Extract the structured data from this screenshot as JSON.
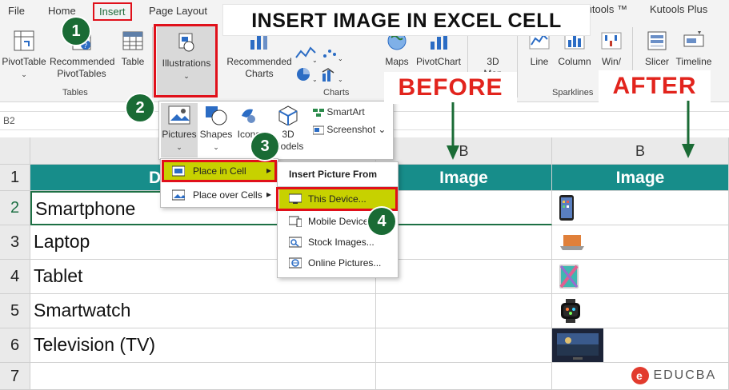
{
  "title_banner": "INSERT IMAGE IN EXCEL CELL",
  "tabs": {
    "file": "File",
    "home": "Home",
    "insert": "Insert",
    "page_layout": "Page Layout",
    "kutools": "Kutools ™",
    "kutools_plus": "Kutools Plus"
  },
  "ribbon": {
    "pivot_table": "PivotTable",
    "recommended_pivot_line1": "Recommended",
    "recommended_pivot_line2": "PivotTables",
    "table": "Table",
    "tables_group": "Tables",
    "illustrations": "Illustrations",
    "recommended_charts_line1": "Recommended",
    "recommended_charts_line2": "Charts",
    "charts_group": "Charts",
    "maps": "Maps",
    "pivot_chart": "PivotChart",
    "threed_map_line1": "3D",
    "threed_map_line2": "Map",
    "line": "Line",
    "column": "Column",
    "win_loss": "Win/",
    "sparklines_group": "Sparklines",
    "slicer": "Slicer",
    "timeline": "Timeline"
  },
  "illustrations_panel": {
    "pictures": "Pictures",
    "shapes": "Shapes",
    "icons": "Icons",
    "threed_line1": "3D",
    "threed_line2": "Models",
    "smartart": "SmartArt",
    "screenshot": "Screenshot"
  },
  "pictures_menu": {
    "place_in_cell": "Place in Cell",
    "place_over_cells": "Place over Cells"
  },
  "insert_picture_menu": {
    "header": "Insert Picture From",
    "items": [
      "This Device...",
      "Mobile Devices...",
      "Stock Images...",
      "Online Pictures..."
    ]
  },
  "name_box": "B2",
  "column_headers": [
    "B",
    "B"
  ],
  "row_numbers": [
    "1",
    "2",
    "3",
    "4",
    "5",
    "6",
    "7"
  ],
  "table": {
    "header_partial": "D",
    "image_header_before": "Image",
    "image_header_after": "Image",
    "devices": [
      "Smartphone",
      "Laptop",
      "Tablet",
      "Smartwatch",
      "Television (TV)"
    ]
  },
  "labels": {
    "before": "BEFORE",
    "after": "AFTER"
  },
  "steps": [
    "1",
    "2",
    "3",
    "4"
  ],
  "watermark": "EDUCBA",
  "colors": {
    "header_teal": "#178d8a",
    "highlight_red": "#e0101a",
    "step_green": "#1a6b35",
    "place_in_cell_fill": "#c7d100"
  },
  "icons": {
    "smartphone_thumb": "smartphone-image",
    "laptop_thumb": "laptop-image",
    "tablet_thumb": "tablet-image",
    "smartwatch_thumb": "smartwatch-image",
    "television_thumb": "television-image"
  }
}
